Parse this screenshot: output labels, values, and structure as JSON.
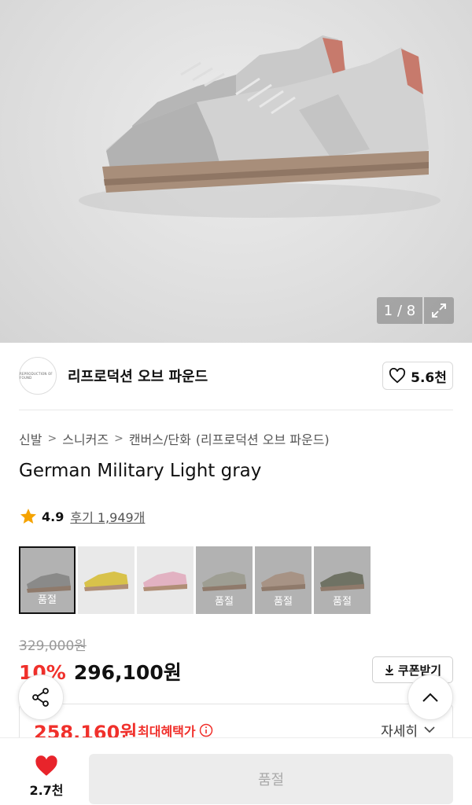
{
  "gallery": {
    "counter": "1 / 8",
    "expand_icon": "expand-icon"
  },
  "brand": {
    "logo_text": "REPRODUCTION OF FOUND",
    "name": "리프로덕션 오브 파운드",
    "likes": "5.6천"
  },
  "breadcrumb": [
    "신발",
    "스니커즈",
    "캔버스/단화",
    "(리프로덕션 오브 파운드)"
  ],
  "product": {
    "title": "German Military Light gray",
    "rating": "4.9",
    "reviews": "후기 1,949개"
  },
  "variants": [
    {
      "sold_out": "품절",
      "color": "#a9a9a7"
    },
    {
      "sold_out": "",
      "color": "#d8c24a"
    },
    {
      "sold_out": "",
      "color": "#e2b2c2"
    },
    {
      "sold_out": "품절",
      "color": "#c9c9b7"
    },
    {
      "sold_out": "품절",
      "color": "#d7b7a1"
    },
    {
      "sold_out": "품절",
      "color": "#7d826b"
    }
  ],
  "price": {
    "original": "329,000원",
    "discount": "10%",
    "sale": "296,100원",
    "coupon": "쿠폰받기",
    "benefit_price": "258,160원",
    "benefit_label": "최대혜택가",
    "detail": "자세히"
  },
  "bottom": {
    "wish_count": "2.7천",
    "buy_label": "품절"
  },
  "colors": {
    "accent_red": "#f0302b",
    "heart_red": "#e8242b"
  }
}
